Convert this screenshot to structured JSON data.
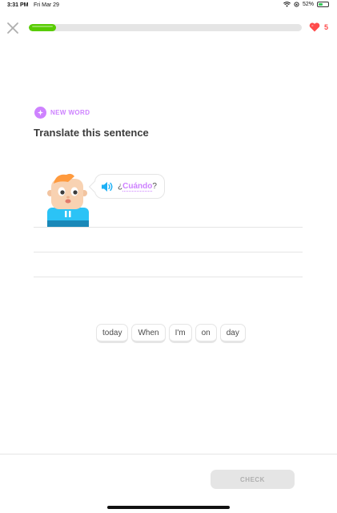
{
  "status_bar": {
    "time": "3:31 PM",
    "date": "Fri Mar 29",
    "battery_percent": "52%",
    "battery_level": 0.52,
    "icons": [
      "wifi-icon",
      "orientation-lock-icon",
      "battery-charging-icon"
    ]
  },
  "header": {
    "close_icon": "close-icon",
    "progress": 0.1,
    "hearts_count": "5",
    "heart_icon": "heart-icon"
  },
  "lesson": {
    "badge_label": "NEW WORD",
    "badge_icon": "new-word-icon",
    "title": "Translate this sentence",
    "prompt_prefix": "¿",
    "prompt_word": "Cuándo",
    "prompt_suffix": "?",
    "speaker_icon": "speaker-icon"
  },
  "word_bank": [
    "today",
    "When",
    "I'm",
    "on",
    "day"
  ],
  "footer": {
    "check_label": "CHECK"
  },
  "colors": {
    "accent_green": "#58cc02",
    "accent_purple": "#ce82ff",
    "heart_red": "#ff4b4b",
    "speaker_blue": "#1cb0f6",
    "border_gray": "#e5e5e5"
  }
}
